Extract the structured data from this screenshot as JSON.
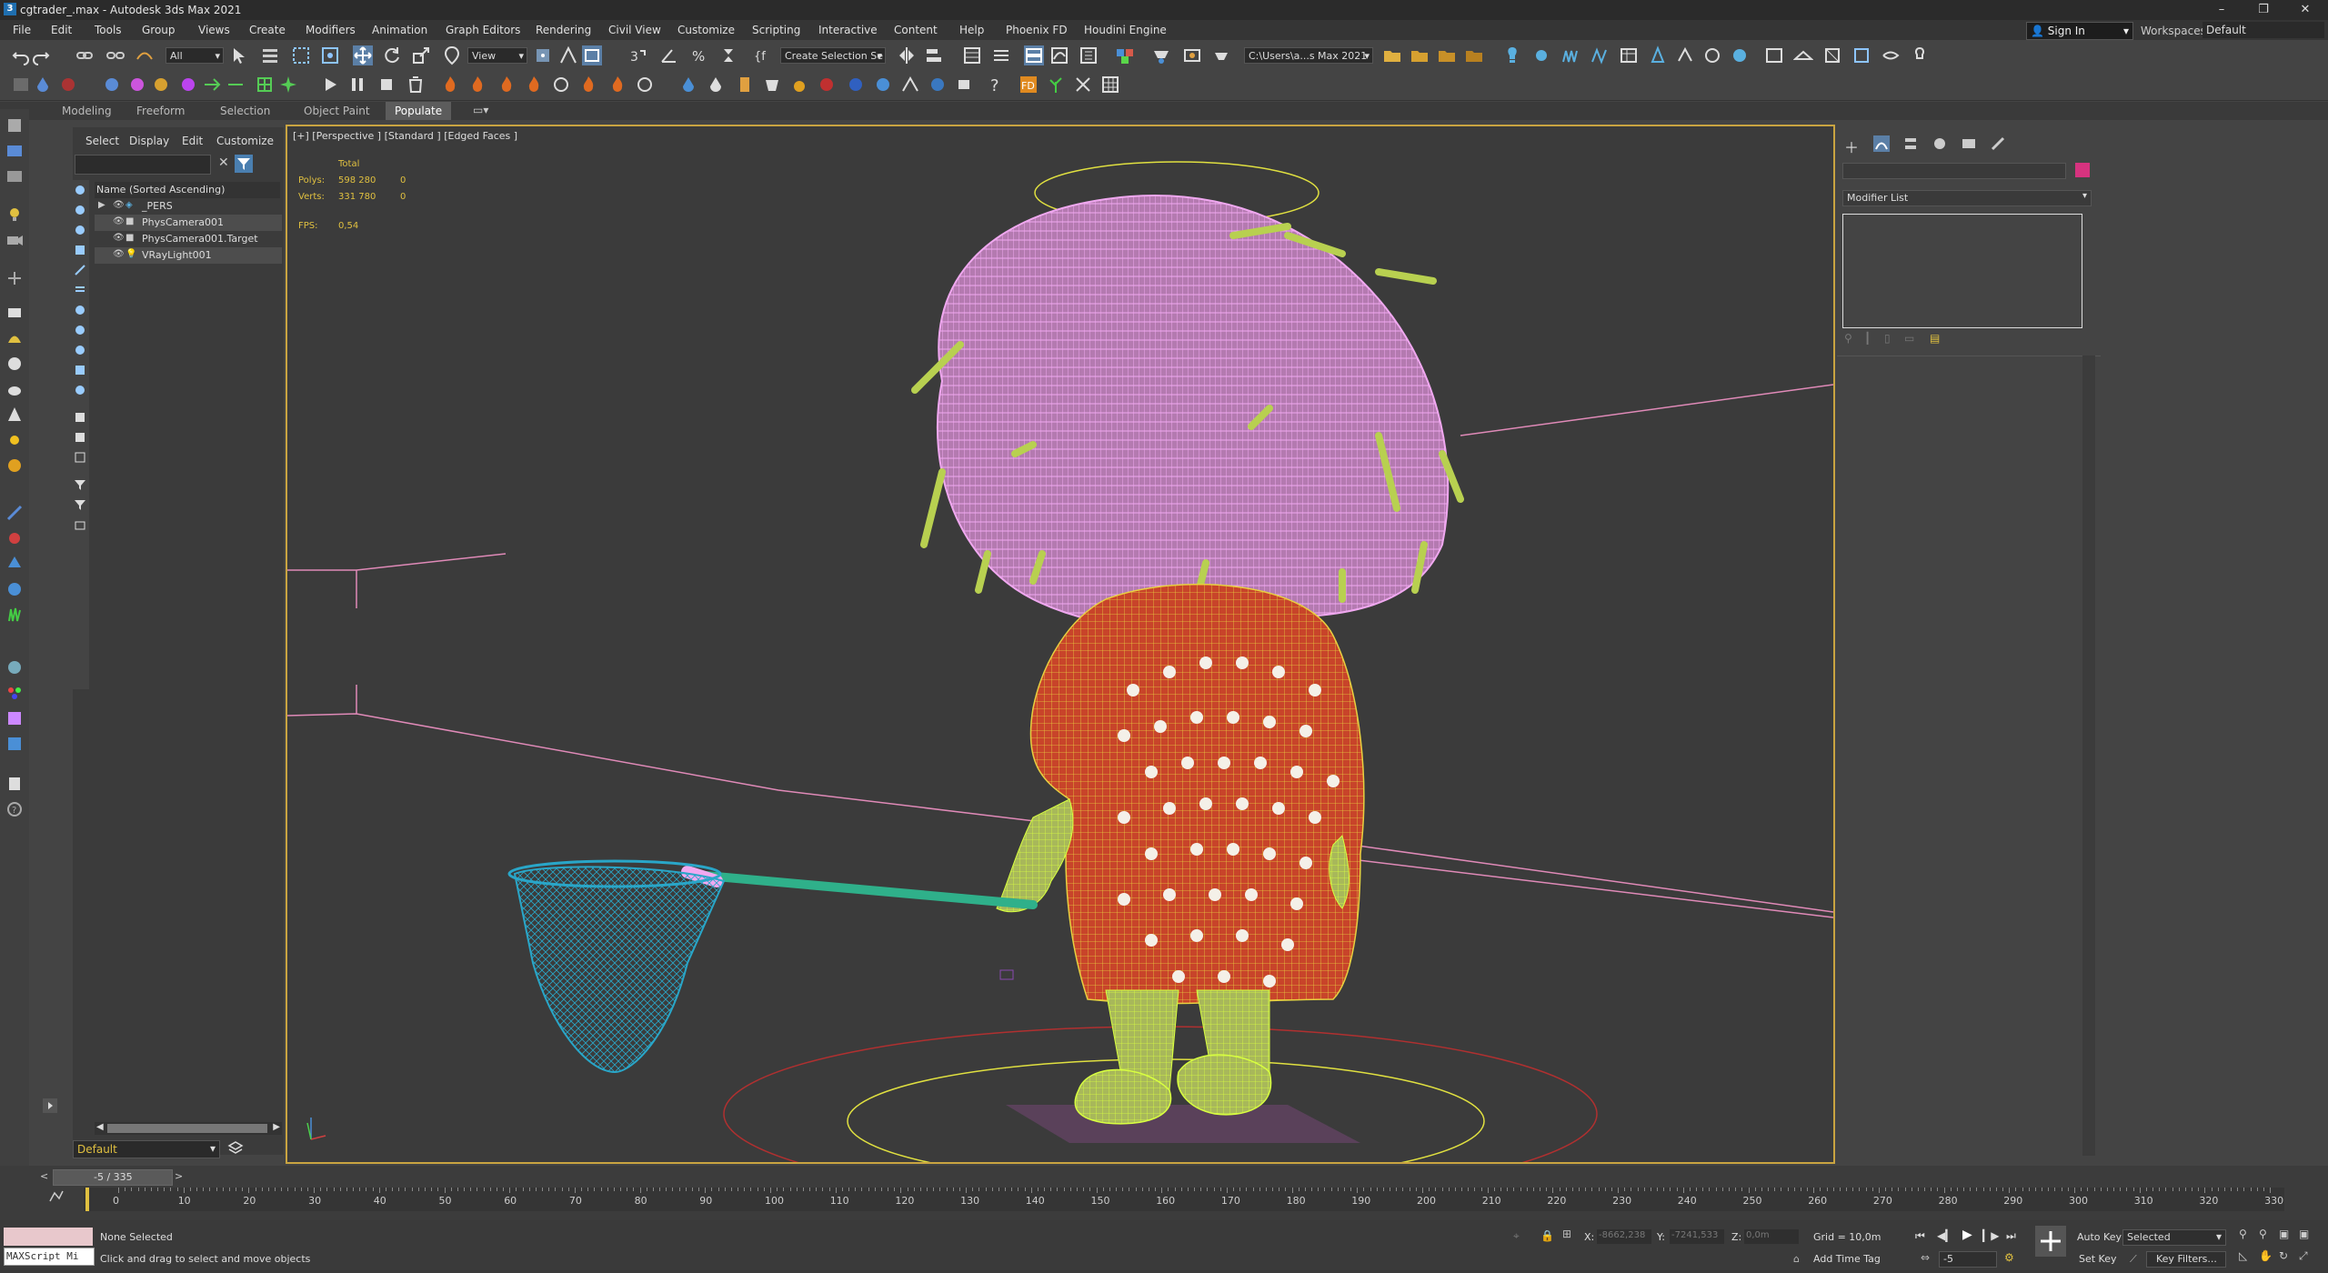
{
  "window": {
    "title": "cgtrader_.max - Autodesk 3ds Max 2021",
    "app_icon": "3"
  },
  "menubar": {
    "items": [
      "File",
      "Edit",
      "Tools",
      "Group",
      "Views",
      "Create",
      "Modifiers",
      "Animation",
      "Graph Editors",
      "Rendering",
      "Civil View",
      "Customize",
      "Scripting",
      "Interactive",
      "Content",
      "Help",
      "Phoenix FD",
      "Houdini Engine"
    ],
    "signin": "Sign In",
    "workspaces_label": "Workspaces:",
    "workspaces_value": "Default"
  },
  "toolbar": {
    "filter": "All",
    "refcoord": "View",
    "selection_set": "Create Selection Se",
    "project_path": "C:\\Users\\a...s Max 2021"
  },
  "ribbon": {
    "tabs": [
      "Modeling",
      "Freeform",
      "Selection",
      "Object Paint",
      "Populate"
    ],
    "active": "Populate"
  },
  "scene_explorer": {
    "menu": [
      "Select",
      "Display",
      "Edit",
      "Customize"
    ],
    "column_header": "Name (Sorted Ascending)",
    "items": [
      "_PERS",
      "PhysCamera001",
      "PhysCamera001.Target",
      "VRayLight001"
    ],
    "layer": "Default"
  },
  "viewport": {
    "label": "[+] [Perspective ] [Standard ] [Edged Faces ]",
    "stats": {
      "total_label": "Total",
      "polys_label": "Polys:",
      "polys_total": "598 280",
      "polys_sel": "0",
      "verts_label": "Verts:",
      "verts_total": "331 780",
      "verts_sel": "0",
      "fps_label": "FPS:",
      "fps_value": "0,54"
    }
  },
  "command_panel": {
    "modifier_list": "Modifier List",
    "color_swatch": "#d6337f"
  },
  "timeline": {
    "frame_display": "-5 / 335",
    "ticks": [
      "0",
      "10",
      "20",
      "30",
      "40",
      "50",
      "60",
      "70",
      "80",
      "90",
      "100",
      "110",
      "120",
      "130",
      "140",
      "150",
      "160",
      "170",
      "180",
      "190",
      "200",
      "210",
      "220",
      "230",
      "240",
      "250",
      "260",
      "270",
      "280",
      "290",
      "300",
      "310",
      "320",
      "330"
    ]
  },
  "status": {
    "maxscript": "MAXScript Mi",
    "selection": "None Selected",
    "prompt": "Click and drag to select and move objects",
    "x_label": "X:",
    "x_value": "-8662,238",
    "y_label": "Y:",
    "y_value": "-7241,533",
    "z_label": "Z:",
    "z_value": "0,0m",
    "grid": "Grid = 10,0m",
    "add_time_tag": "Add Time Tag",
    "auto_key": "Auto Key",
    "set_key": "Set Key",
    "key_mode": "Selected",
    "key_filters": "Key Filters...",
    "current_frame": "-5"
  }
}
